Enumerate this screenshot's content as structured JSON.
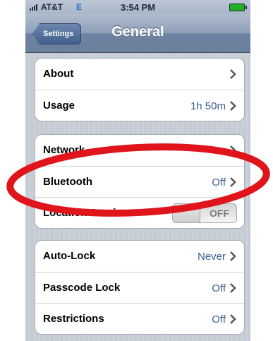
{
  "status_bar": {
    "carrier": "AT&T",
    "network": "E",
    "time": "3:54 PM",
    "signal_icon": "signal-bars-icon",
    "battery_icon": "battery-icon",
    "battery_color": "#23b123"
  },
  "nav": {
    "back_label": "Settings",
    "title": "General"
  },
  "groups": [
    {
      "cells": [
        {
          "label": "About",
          "value": ""
        },
        {
          "label": "Usage",
          "value": "1h 50m"
        }
      ]
    },
    {
      "cells": [
        {
          "label": "Network",
          "value": ""
        },
        {
          "label": "Bluetooth",
          "value": "Off"
        },
        {
          "label": "Location Services",
          "toggle": "OFF"
        }
      ]
    },
    {
      "cells": [
        {
          "label": "Auto-Lock",
          "value": "Never"
        },
        {
          "label": "Passcode Lock",
          "value": "Off"
        },
        {
          "label": "Restrictions",
          "value": "Off"
        }
      ]
    }
  ],
  "annotation": {
    "shape": "ellipse",
    "color": "#e0141b"
  },
  "colors": {
    "value_text": "#3c5f8f",
    "nav_bar": "#6d83a1",
    "background": "#c5ccd4"
  }
}
